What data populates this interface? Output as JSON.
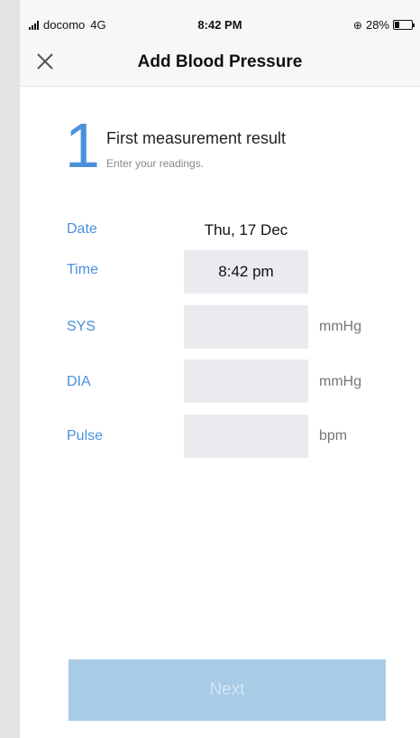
{
  "status_bar": {
    "carrier": "docomo",
    "network": "4G",
    "time": "8:42 PM",
    "battery": "28%",
    "battery_level": 0.28
  },
  "nav": {
    "title": "Add Blood Pressure"
  },
  "step": {
    "number": "1",
    "title": "First measurement result",
    "subtitle": "Enter your readings."
  },
  "form": {
    "date_label": "Date",
    "date_value": "Thu, 17 Dec",
    "time_label": "Time",
    "time_value": "8:42 pm",
    "sys_label": "SYS",
    "sys_value": "",
    "sys_unit": "mmHg",
    "dia_label": "DIA",
    "dia_value": "",
    "dia_unit": "mmHg",
    "pulse_label": "Pulse",
    "pulse_value": "",
    "pulse_unit": "bpm"
  },
  "next_button": {
    "label": "Next"
  },
  "colors": {
    "accent": "#4a90d9",
    "field_bg": "#e9ebee",
    "button_disabled": "#a8cbe6"
  }
}
